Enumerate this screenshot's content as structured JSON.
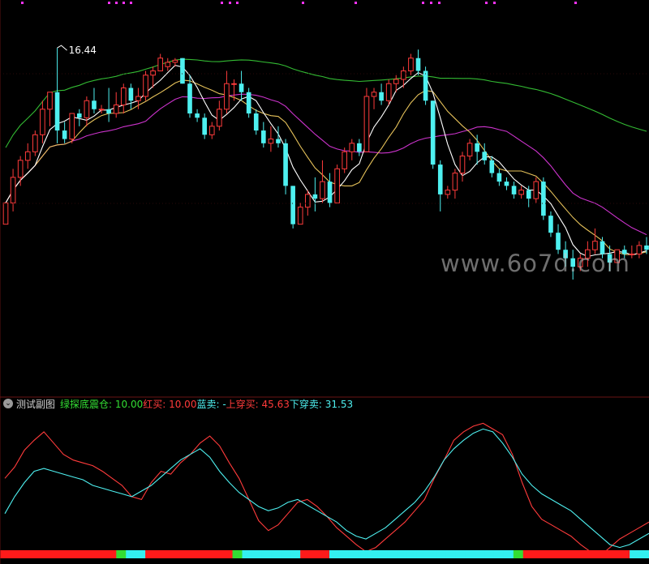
{
  "chart_data": [
    {
      "type": "candlestick",
      "title": "",
      "price_annotation": "16.44",
      "ylim": [
        11.0,
        17.45
      ],
      "colors": {
        "up": "#ff3b3b",
        "down": "#4ef0f0",
        "ma5": "#ffffff",
        "ma10": "#e6c25a",
        "ma20": "#cc33cc",
        "ma60": "#33bb33"
      },
      "ohlc": [
        [
          12.3,
          12.8,
          12.3,
          12.8
        ],
        [
          12.8,
          13.6,
          12.6,
          13.4
        ],
        [
          13.4,
          13.9,
          13.2,
          13.8
        ],
        [
          13.8,
          14.2,
          13.6,
          14.0
        ],
        [
          14.0,
          14.5,
          13.9,
          14.4
        ],
        [
          14.4,
          15.2,
          14.2,
          15.0
        ],
        [
          15.0,
          15.4,
          14.6,
          15.4
        ],
        [
          15.4,
          16.44,
          14.2,
          14.5
        ],
        [
          14.5,
          14.7,
          14.2,
          14.3
        ],
        [
          14.3,
          14.9,
          14.2,
          14.9
        ],
        [
          14.9,
          15.0,
          14.6,
          14.8
        ],
        [
          14.8,
          15.3,
          14.6,
          15.2
        ],
        [
          15.2,
          15.5,
          14.9,
          15.0
        ],
        [
          15.0,
          15.1,
          14.9,
          15.0
        ],
        [
          15.0,
          15.5,
          14.7,
          14.9
        ],
        [
          14.9,
          15.4,
          14.8,
          15.1
        ],
        [
          15.1,
          15.6,
          14.9,
          15.5
        ],
        [
          15.5,
          15.6,
          15.0,
          15.2
        ],
        [
          15.2,
          15.5,
          15.0,
          15.3
        ],
        [
          15.3,
          15.9,
          15.2,
          15.8
        ],
        [
          15.8,
          16.0,
          15.5,
          15.9
        ],
        [
          15.9,
          16.3,
          15.9,
          16.2
        ],
        [
          16.0,
          16.2,
          15.9,
          16.1
        ],
        [
          16.1,
          16.2,
          16.0,
          16.15
        ],
        [
          16.2,
          16.2,
          15.6,
          15.6
        ],
        [
          15.6,
          15.8,
          14.8,
          14.9
        ],
        [
          14.9,
          15.0,
          14.7,
          14.8
        ],
        [
          14.8,
          14.9,
          14.3,
          14.4
        ],
        [
          14.4,
          14.7,
          14.3,
          14.6
        ],
        [
          14.6,
          15.2,
          14.5,
          15.0
        ],
        [
          15.0,
          15.9,
          14.9,
          15.6
        ],
        [
          15.6,
          15.7,
          15.2,
          15.6
        ],
        [
          15.6,
          15.9,
          15.2,
          15.4
        ],
        [
          15.4,
          15.5,
          14.8,
          14.9
        ],
        [
          14.9,
          15.0,
          14.4,
          14.5
        ],
        [
          14.5,
          14.7,
          14.1,
          14.2
        ],
        [
          14.2,
          14.6,
          14.0,
          14.3
        ],
        [
          14.3,
          14.6,
          14.1,
          14.2
        ],
        [
          14.2,
          14.3,
          13.0,
          13.2
        ],
        [
          13.2,
          13.2,
          12.2,
          12.3
        ],
        [
          12.3,
          12.8,
          12.3,
          12.7
        ],
        [
          12.7,
          13.1,
          12.5,
          13.0
        ],
        [
          13.0,
          13.4,
          12.6,
          12.9
        ],
        [
          12.9,
          13.8,
          12.8,
          13.3
        ],
        [
          13.3,
          13.5,
          12.7,
          12.8
        ],
        [
          12.8,
          13.7,
          12.8,
          13.6
        ],
        [
          13.6,
          14.1,
          13.5,
          14.0
        ],
        [
          14.0,
          14.3,
          13.8,
          14.2
        ],
        [
          14.2,
          14.3,
          13.9,
          14.0
        ],
        [
          14.0,
          15.5,
          14.0,
          15.3
        ],
        [
          15.3,
          15.5,
          15.0,
          15.4
        ],
        [
          15.4,
          15.6,
          15.1,
          15.2
        ],
        [
          15.2,
          15.7,
          15.1,
          15.6
        ],
        [
          15.6,
          15.8,
          15.4,
          15.7
        ],
        [
          15.7,
          16.0,
          15.5,
          15.9
        ],
        [
          15.9,
          16.3,
          15.8,
          16.2
        ],
        [
          16.2,
          16.4,
          15.8,
          15.9
        ],
        [
          15.9,
          16.0,
          15.1,
          15.2
        ],
        [
          15.2,
          15.2,
          13.6,
          13.7
        ],
        [
          13.7,
          13.8,
          12.6,
          13.0
        ],
        [
          13.0,
          13.2,
          12.9,
          13.1
        ],
        [
          13.1,
          13.6,
          12.9,
          13.5
        ],
        [
          13.5,
          14.0,
          13.3,
          13.9
        ],
        [
          13.9,
          14.3,
          13.8,
          14.2
        ],
        [
          14.2,
          14.4,
          13.7,
          14.0
        ],
        [
          14.0,
          14.2,
          13.7,
          13.8
        ],
        [
          13.8,
          13.9,
          13.4,
          13.5
        ],
        [
          13.5,
          13.6,
          13.2,
          13.3
        ],
        [
          13.3,
          13.4,
          13.1,
          13.2
        ],
        [
          13.2,
          13.3,
          12.9,
          13.0
        ],
        [
          13.0,
          13.2,
          12.9,
          13.1
        ],
        [
          13.1,
          13.2,
          12.7,
          12.9
        ],
        [
          12.9,
          13.4,
          12.8,
          13.3
        ],
        [
          13.3,
          13.4,
          12.4,
          12.5
        ],
        [
          12.5,
          12.6,
          12.0,
          12.1
        ],
        [
          12.1,
          12.3,
          11.6,
          11.7
        ],
        [
          11.7,
          11.9,
          11.3,
          11.5
        ],
        [
          11.5,
          11.7,
          11.0,
          11.3
        ],
        [
          11.3,
          11.6,
          11.2,
          11.5
        ],
        [
          11.5,
          11.9,
          11.3,
          11.7
        ],
        [
          11.7,
          12.2,
          11.6,
          11.9
        ],
        [
          11.9,
          12.0,
          11.5,
          11.6
        ],
        [
          11.6,
          11.8,
          11.2,
          11.4
        ],
        [
          11.4,
          11.7,
          11.4,
          11.7
        ],
        [
          11.7,
          11.8,
          11.5,
          11.6
        ],
        [
          11.6,
          11.8,
          11.5,
          11.6
        ],
        [
          11.6,
          11.9,
          11.5,
          11.8
        ],
        [
          11.8,
          12.0,
          11.6,
          11.7
        ]
      ]
    },
    {
      "type": "line",
      "indicator_name": "测试副图",
      "legend": [
        {
          "label": "绿探底震仓: ",
          "value": "10.00",
          "color": "#33dd33"
        },
        {
          "label": "红买: ",
          "value": "10.00",
          "color": "#ff3b3b"
        },
        {
          "label": "蓝卖: ",
          "value": "-",
          "color": "#4ef0f0"
        },
        {
          "label": "上穿买: ",
          "value": "45.63",
          "color": "#ff3b3b"
        },
        {
          "label": "下穿卖: ",
          "value": "31.53",
          "color": "#4ef0f0"
        }
      ],
      "ylim": [
        0,
        100
      ],
      "series": [
        {
          "color": "#ff3b3b",
          "values": [
            55,
            63,
            75,
            82,
            88,
            80,
            72,
            68,
            66,
            64,
            60,
            55,
            50,
            42,
            40,
            52,
            60,
            58,
            66,
            72,
            80,
            85,
            78,
            66,
            55,
            40,
            25,
            18,
            22,
            30,
            38,
            40,
            35,
            28,
            20,
            14,
            8,
            3,
            6,
            12,
            18,
            24,
            32,
            40,
            55,
            68,
            82,
            88,
            92,
            94,
            90,
            86,
            72,
            52,
            35,
            26,
            22,
            18,
            14,
            8,
            3,
            0,
            6,
            12,
            16,
            20,
            24
          ]
        },
        {
          "color": "#4ef0f0",
          "values": [
            30,
            42,
            52,
            60,
            62,
            60,
            58,
            56,
            54,
            50,
            48,
            46,
            44,
            42,
            46,
            50,
            56,
            62,
            68,
            72,
            76,
            70,
            60,
            52,
            45,
            40,
            35,
            32,
            34,
            38,
            40,
            36,
            32,
            28,
            24,
            18,
            14,
            12,
            16,
            20,
            26,
            32,
            38,
            46,
            56,
            68,
            76,
            82,
            87,
            90,
            88,
            80,
            70,
            58,
            50,
            44,
            40,
            36,
            32,
            26,
            20,
            14,
            8,
            6,
            8,
            12,
            16
          ]
        }
      ],
      "signal_band": [
        "R",
        "R",
        "R",
        "R",
        "R",
        "R",
        "R",
        "R",
        "R",
        "R",
        "R",
        "R",
        "G",
        "C",
        "C",
        "R",
        "R",
        "R",
        "R",
        "R",
        "R",
        "R",
        "R",
        "R",
        "G",
        "C",
        "C",
        "C",
        "C",
        "C",
        "C",
        "R",
        "R",
        "R",
        "C",
        "C",
        "C",
        "C",
        "C",
        "C",
        "C",
        "C",
        "C",
        "C",
        "C",
        "C",
        "C",
        "C",
        "C",
        "C",
        "C",
        "C",
        "C",
        "G",
        "R",
        "R",
        "R",
        "R",
        "R",
        "R",
        "R",
        "R",
        "R",
        "R",
        "R",
        "C",
        "C"
      ]
    }
  ],
  "watermark": "www.6o7d.com"
}
